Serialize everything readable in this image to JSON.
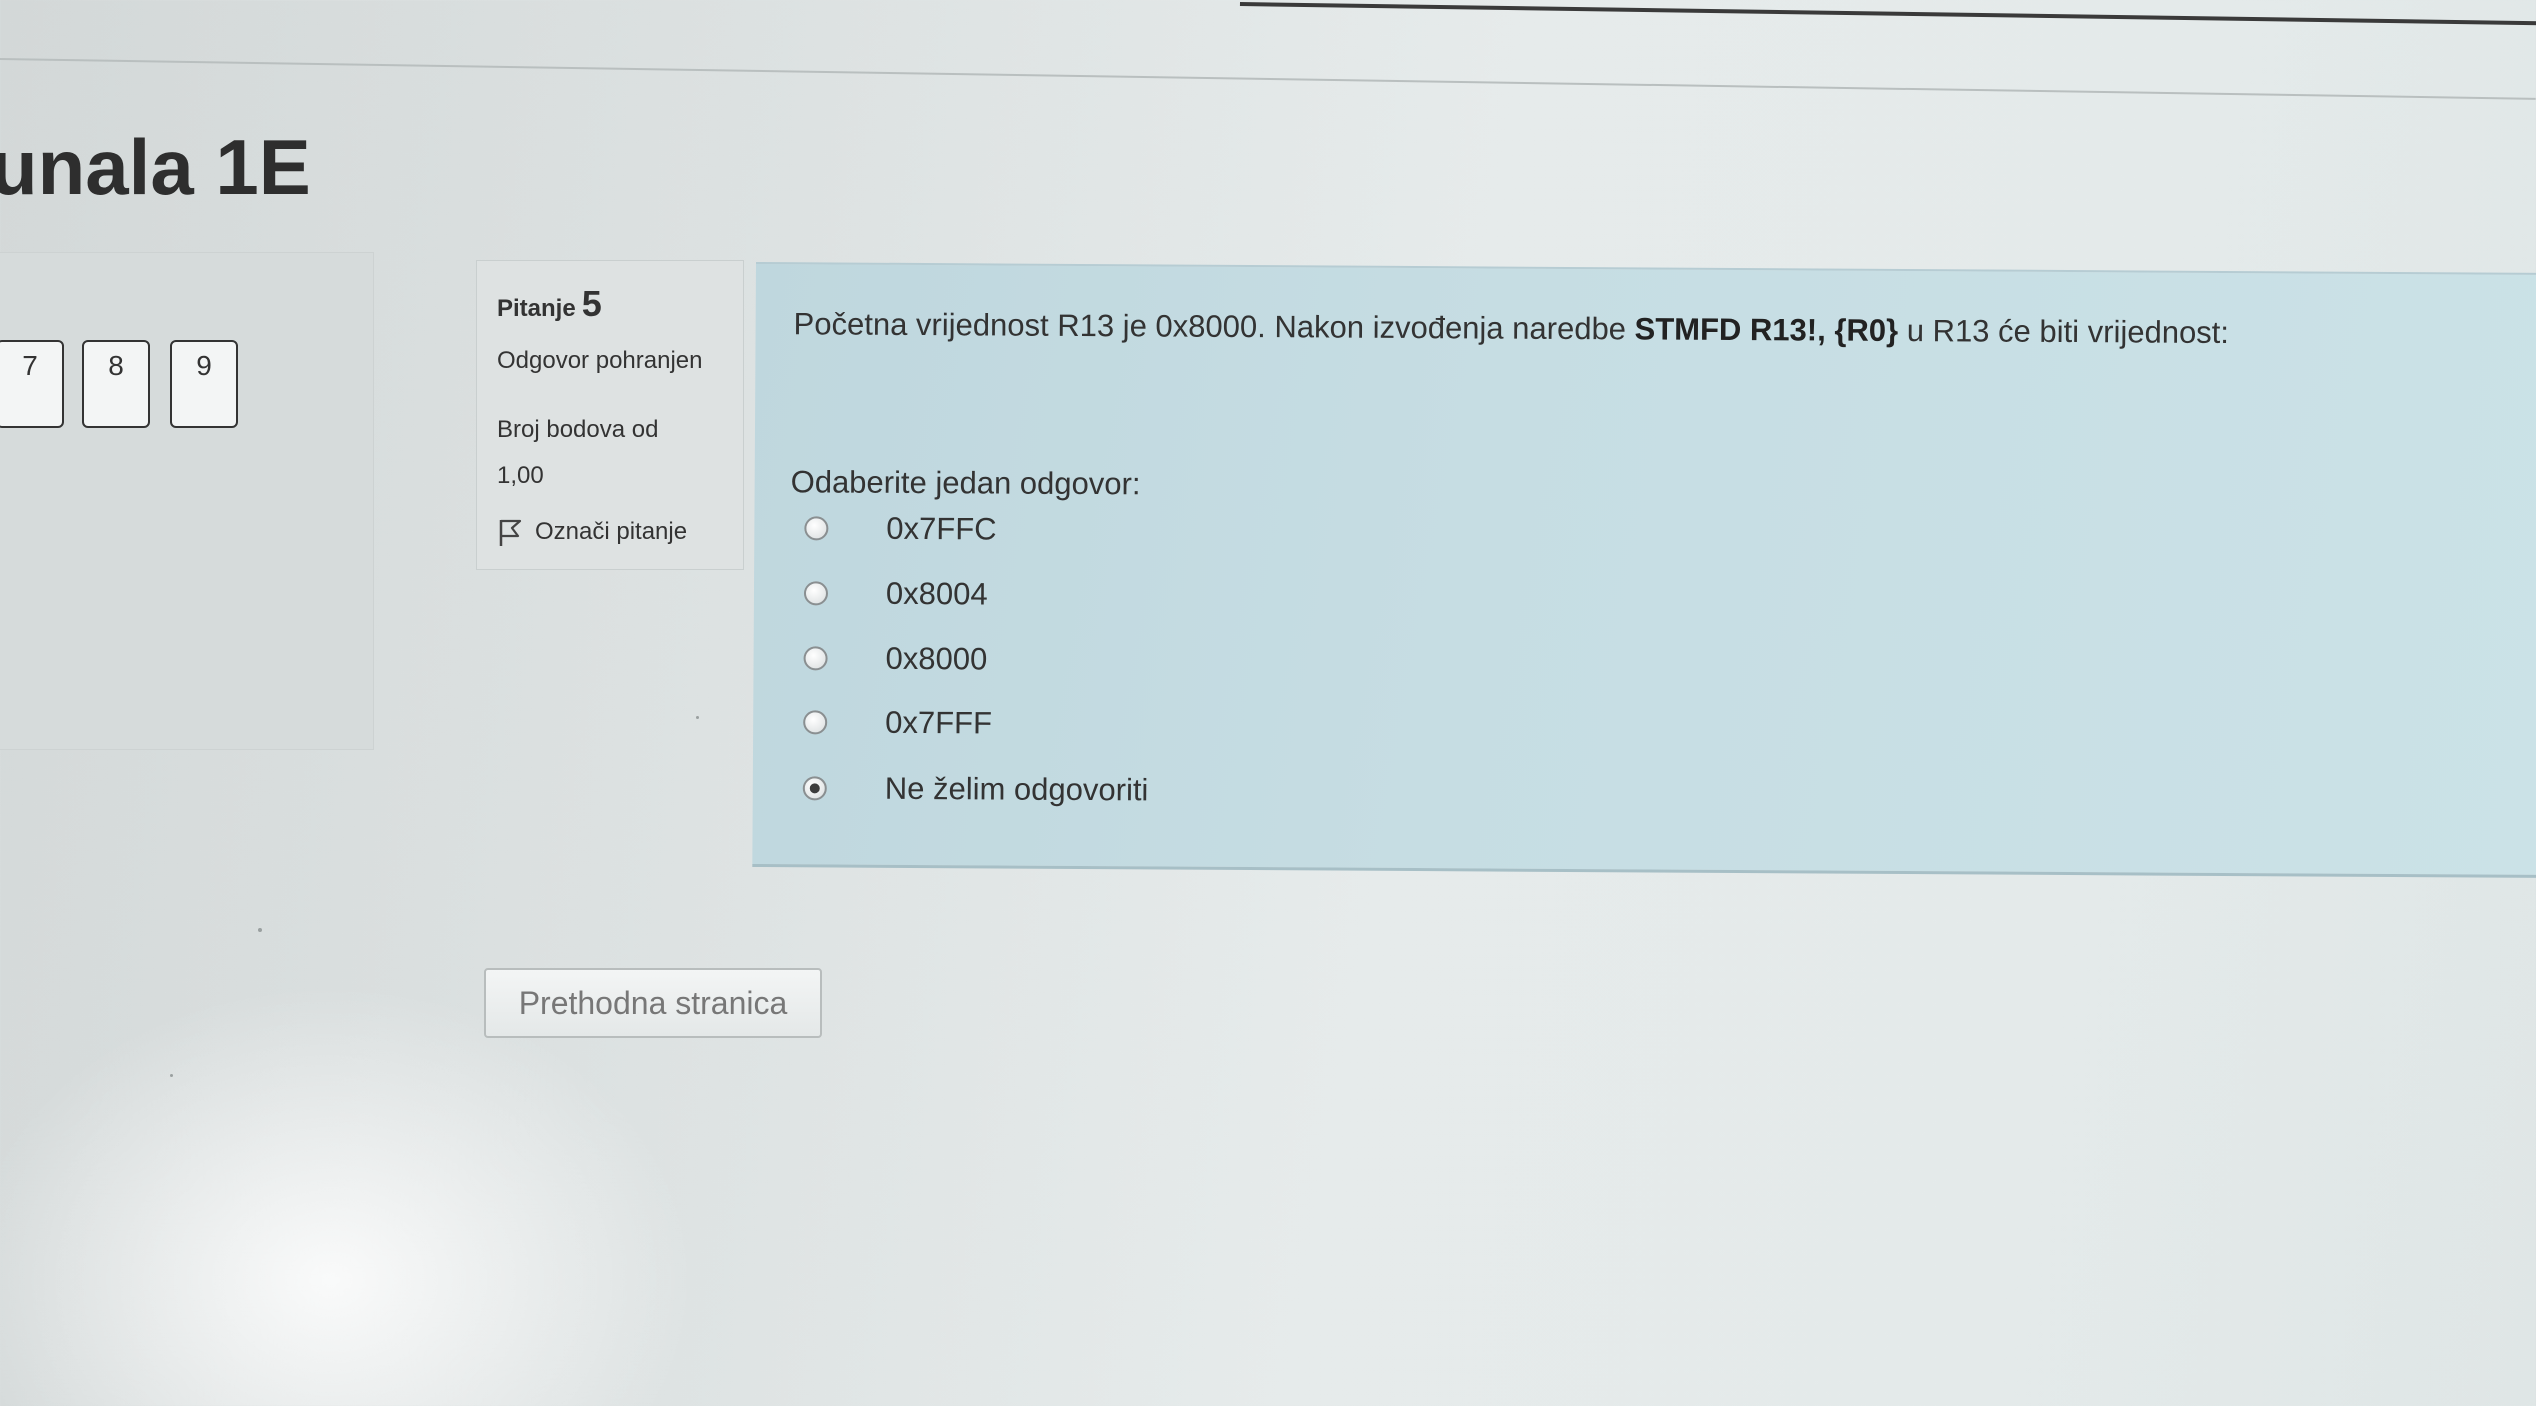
{
  "page": {
    "title": "unala 1E"
  },
  "navigation": {
    "buttons": [
      "7",
      "8",
      "9"
    ]
  },
  "question_info": {
    "label": "Pitanje",
    "number": "5",
    "state": "Odgovor pohranjen",
    "grade_label": "Broj bodova od",
    "grade_value": "1,00",
    "flag_label": "Označi pitanje"
  },
  "question": {
    "text_before": "Početna vrijednost R13 je 0x8000. Nakon izvođenja naredbe ",
    "text_bold": "STMFD R13!, {R0}",
    "text_after": " u R13 će biti vrijednost:",
    "prompt": "Odaberite jedan odgovor:",
    "answers": [
      {
        "label": "0x7FFC",
        "selected": false
      },
      {
        "label": "0x8004",
        "selected": false
      },
      {
        "label": "0x8000",
        "selected": false
      },
      {
        "label": "0x7FFF",
        "selected": false
      },
      {
        "label": "Ne želim odgovoriti",
        "selected": true
      }
    ]
  },
  "footer": {
    "prev_button": "Prethodna stranica"
  }
}
